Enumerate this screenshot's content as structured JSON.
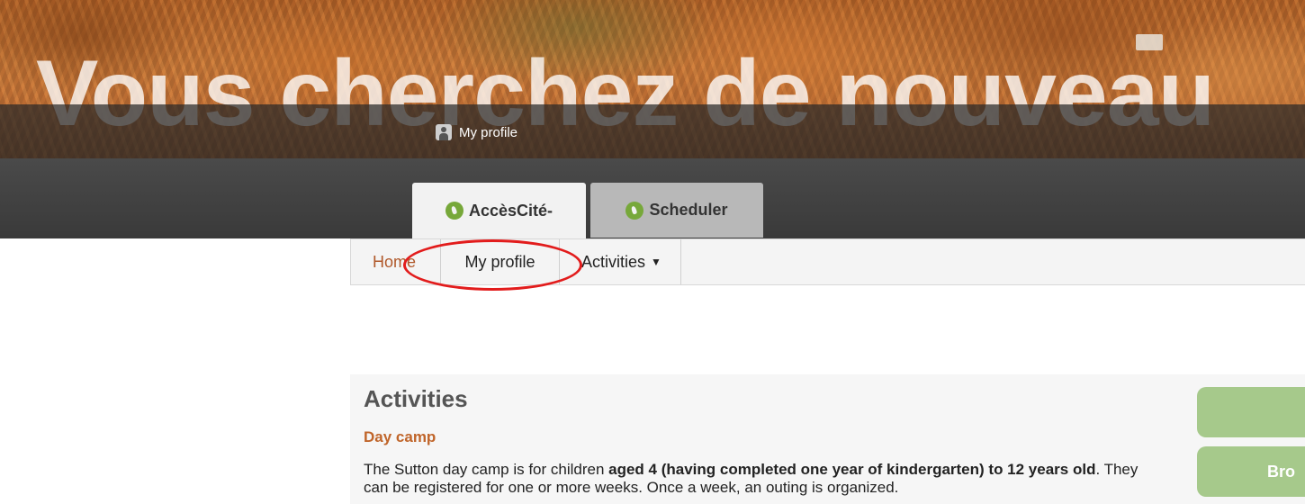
{
  "banner": {
    "slogan": "Vous cherchez de nouveau",
    "profile_link": "My profile"
  },
  "app_tabs": [
    {
      "label": "AccèsCité-",
      "icon": "leaf-icon",
      "active": true
    },
    {
      "label": "Scheduler",
      "icon": "leaf-icon",
      "active": false
    }
  ],
  "subnav": {
    "home": "Home",
    "profile": "My profile",
    "activities": "Activities",
    "activities_caret": "▼"
  },
  "main": {
    "title": "Activities",
    "section": "Day camp",
    "desc_1": "The Sutton day camp is for children ",
    "desc_bold_1": "aged 4 (having completed one year of kindergarten) to 12 years old",
    "desc_2": ". They can be registered for one or more weeks. Once a week, an outing is organized."
  },
  "side_buttons": {
    "top": "",
    "bottom": "Bro"
  },
  "colors": {
    "accent_green": "#77a83a",
    "button_green": "#a6c98b",
    "link_orange": "#b0582a",
    "annotation_red": "#e21c1c"
  }
}
